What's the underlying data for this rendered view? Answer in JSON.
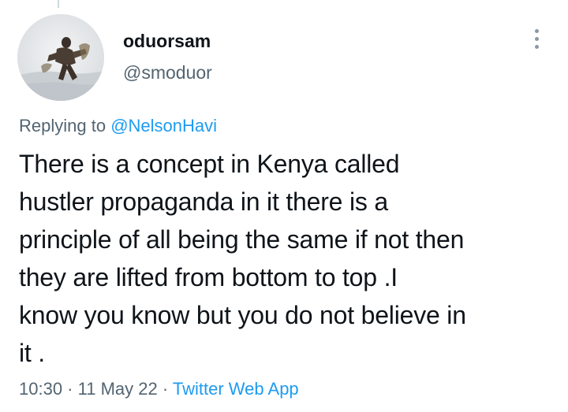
{
  "author": {
    "display_name": "oduorsam",
    "handle": "@smoduor"
  },
  "reply": {
    "prefix": "Replying to ",
    "mention": "@NelsonHavi"
  },
  "tweet": {
    "text": "There is a concept in Kenya called\nhustler propaganda in it there is a\nprinciple of all being the same if not then\nthey are lifted from bottom to top .I\nknow you know but you do not believe in\nit ."
  },
  "meta": {
    "time": "10:30",
    "separator_1": " · ",
    "date": "11 May 22",
    "separator_2": " · ",
    "source": "Twitter Web App"
  },
  "icons": {
    "more": "more-vertical-icon"
  },
  "colors": {
    "text_primary": "#0f1419",
    "text_secondary": "#536471",
    "link": "#1d9bf0"
  }
}
